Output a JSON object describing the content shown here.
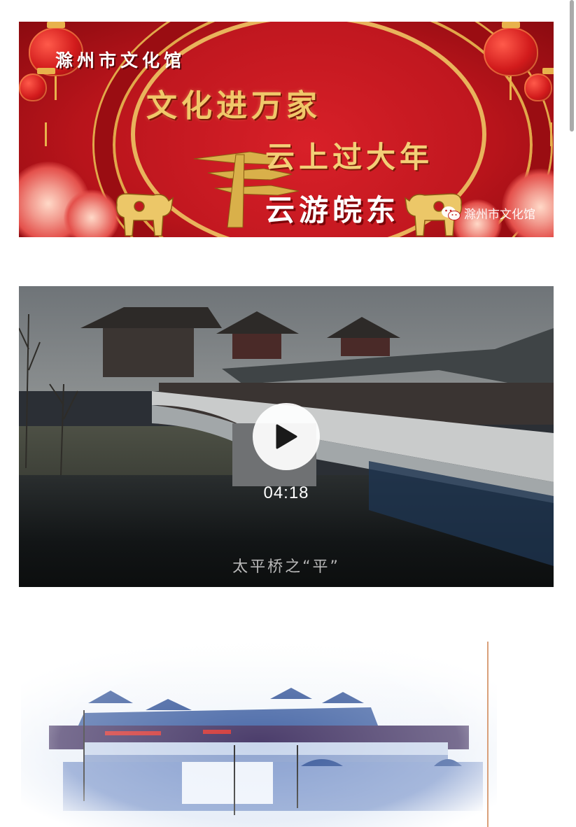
{
  "banner": {
    "org_title": "滁州市文化馆",
    "line1": "文化进万家",
    "line2": "云上过大年",
    "line3": "云游皖东",
    "watermark": "滁州市文化馆"
  },
  "video": {
    "duration": "04:18",
    "subtitle": "太平桥之“平”"
  },
  "icons": {
    "play": "play-icon",
    "wechat": "wechat-icon"
  },
  "colors": {
    "banner_red": "#c0171f",
    "banner_gold": "#f0c86a",
    "divider": "#d9a07a"
  }
}
